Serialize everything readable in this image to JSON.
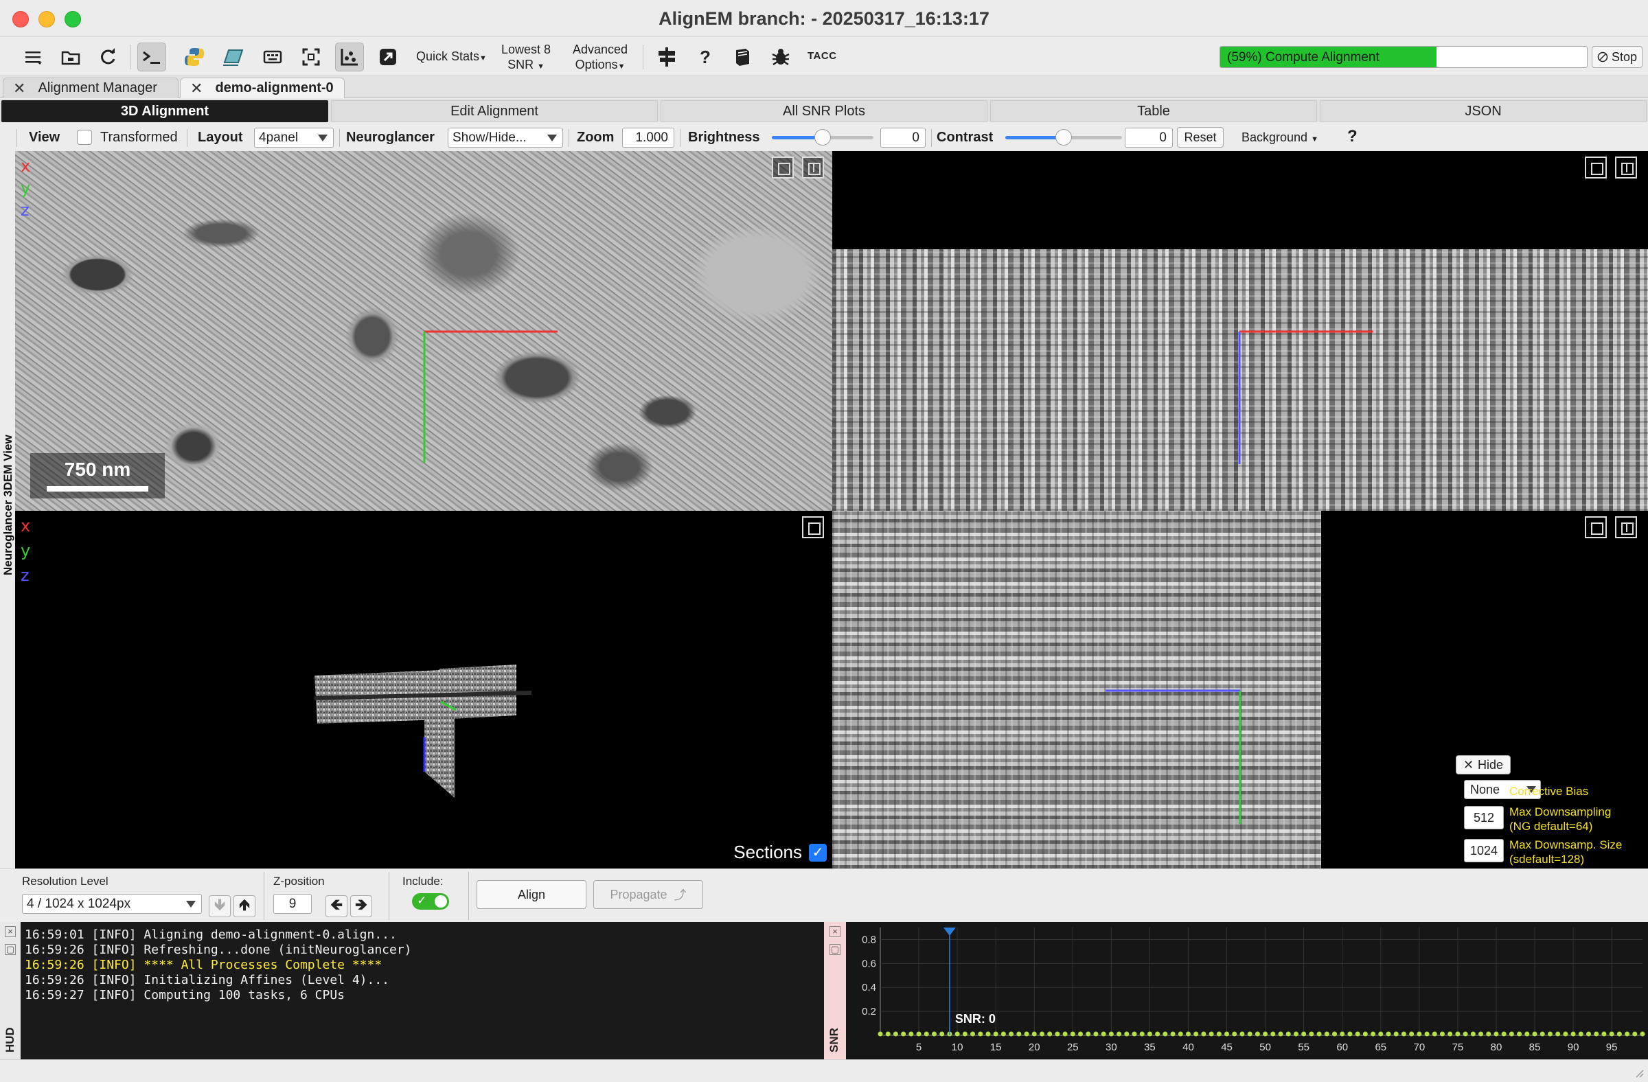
{
  "window": {
    "title": "AlignEM branch:  - 20250317_16:13:17"
  },
  "toolbar": {
    "quick_stats": "Quick Stats",
    "lowest8_line1": "Lowest 8",
    "lowest8_line2": "SNR",
    "advanced_line1": "Advanced",
    "advanced_line2": "Options",
    "tacc": "TACC",
    "help_glyph": "?",
    "progress_text": "(59%) Compute Alignment",
    "progress_value": 0.59,
    "stop_label": "Stop",
    "icons": [
      "menu-icon",
      "folder-icon",
      "refresh-icon",
      "terminal-icon",
      "python-icon",
      "notebook-icon",
      "keyboard-icon",
      "fullscreen-icon",
      "plot-icon",
      "external-link-icon",
      "signpost-icon",
      "help-icon",
      "book-icon",
      "bug-icon"
    ]
  },
  "doc_tabs": [
    {
      "label": "Alignment Manager"
    },
    {
      "label": "demo-alignment-0"
    }
  ],
  "sub_tabs": [
    {
      "label": "3D Alignment"
    },
    {
      "label": "Edit Alignment"
    },
    {
      "label": "All SNR Plots"
    },
    {
      "label": "Table"
    },
    {
      "label": "JSON"
    }
  ],
  "controls": {
    "view_label": "View",
    "transformed_label": "Transformed",
    "layout_label": "Layout",
    "layout_value": "4panel",
    "neuroglancer_label": "Neuroglancer",
    "neuroglancer_value": "Show/Hide...",
    "zoom_label": "Zoom",
    "zoom_value": "1.000",
    "brightness_label": "Brightness",
    "brightness_value": "0",
    "contrast_label": "Contrast",
    "contrast_value": "0",
    "reset_label": "Reset",
    "background_label": "Background",
    "help_glyph": "?"
  },
  "side_label": "Neuroglancer 3DEM View",
  "viewer": {
    "axes": {
      "x": "x",
      "y": "y",
      "z": "z"
    },
    "scale_bar": "750 nm",
    "sections_label": "Sections",
    "sections_checked": true,
    "colors": {
      "x": "#e33333",
      "y": "#33cc33",
      "z": "#5555ff"
    }
  },
  "overlay": {
    "hide_label": "Hide",
    "bias_value": "None",
    "bias_label": "Corrective Bias",
    "max_ds_value": "512",
    "max_ds_label1": "Max Downsampling",
    "max_ds_label2": "(NG default=64)",
    "max_size_value": "1024",
    "max_size_label1": "Max Downsamp. Size",
    "max_size_label2": "(sdefault=128)"
  },
  "bottom": {
    "resolution_label": "Resolution Level",
    "resolution_value": "4 / 1024 x 1024px",
    "zpos_label": "Z-position",
    "zpos_value": "9",
    "include_label": "Include:",
    "include_on": true,
    "align_label": "Align",
    "propagate_label": "Propagate"
  },
  "hud": {
    "label": "HUD",
    "lines": [
      "16:59:01 [INFO] Aligning demo-alignment-0.align...",
      "16:59:26 [INFO] Refreshing...done (initNeuroglancer)",
      "16:59:26 [INFO] **** All Processes Complete ****",
      "16:59:26 [INFO] Initializing Affines (Level 4)...",
      "16:59:27 [INFO] Computing 100 tasks, 6 CPUs"
    ]
  },
  "snr_plot": {
    "side_label": "SNR",
    "annotation": "SNR: 0"
  },
  "chart_data": {
    "type": "scatter",
    "title": "",
    "xlabel": "",
    "ylabel": "",
    "x_ticks": [
      5,
      10,
      15,
      20,
      25,
      30,
      35,
      40,
      45,
      50,
      55,
      60,
      65,
      70,
      75,
      80,
      85,
      90,
      95
    ],
    "y_ticks": [
      0.2,
      0.4,
      0.6,
      0.8
    ],
    "xlim": [
      0,
      99
    ],
    "ylim": [
      0,
      0.9
    ],
    "marker_x": 9,
    "series": [
      {
        "x": [
          0,
          1,
          2,
          3,
          4,
          5,
          6,
          7,
          8,
          9,
          10,
          11,
          12,
          13,
          14,
          15,
          16,
          17,
          18,
          19,
          20,
          21,
          22,
          23,
          24,
          25,
          26,
          27,
          28,
          29,
          30,
          31,
          32,
          33,
          34,
          35,
          36,
          37,
          38,
          39,
          40,
          41,
          42,
          43,
          44,
          45,
          46,
          47,
          48,
          49,
          50,
          51,
          52,
          53,
          54,
          55,
          56,
          57,
          58,
          59,
          60,
          61,
          62,
          63,
          64,
          65,
          66,
          67,
          68,
          69,
          70,
          71,
          72,
          73,
          74,
          75,
          76,
          77,
          78,
          79,
          80,
          81,
          82,
          83,
          84,
          85,
          86,
          87,
          88,
          89,
          90,
          91,
          92,
          93,
          94,
          95,
          96,
          97,
          98,
          99
        ],
        "values": [
          0,
          0,
          0,
          0,
          0,
          0,
          0,
          0,
          0,
          0,
          0,
          0,
          0,
          0,
          0,
          0,
          0,
          0,
          0,
          0,
          0,
          0,
          0,
          0,
          0,
          0,
          0,
          0,
          0,
          0,
          0,
          0,
          0,
          0,
          0,
          0,
          0,
          0,
          0,
          0,
          0,
          0,
          0,
          0,
          0,
          0,
          0,
          0,
          0,
          0,
          0,
          0,
          0,
          0,
          0,
          0,
          0,
          0,
          0,
          0,
          0,
          0,
          0,
          0,
          0,
          0,
          0,
          0,
          0,
          0,
          0,
          0,
          0,
          0,
          0,
          0,
          0,
          0,
          0,
          0,
          0,
          0,
          0,
          0,
          0,
          0,
          0,
          0,
          0,
          0,
          0,
          0,
          0,
          0,
          0,
          0,
          0,
          0,
          0,
          0
        ],
        "color": "#b5e048"
      }
    ],
    "grid": true
  }
}
